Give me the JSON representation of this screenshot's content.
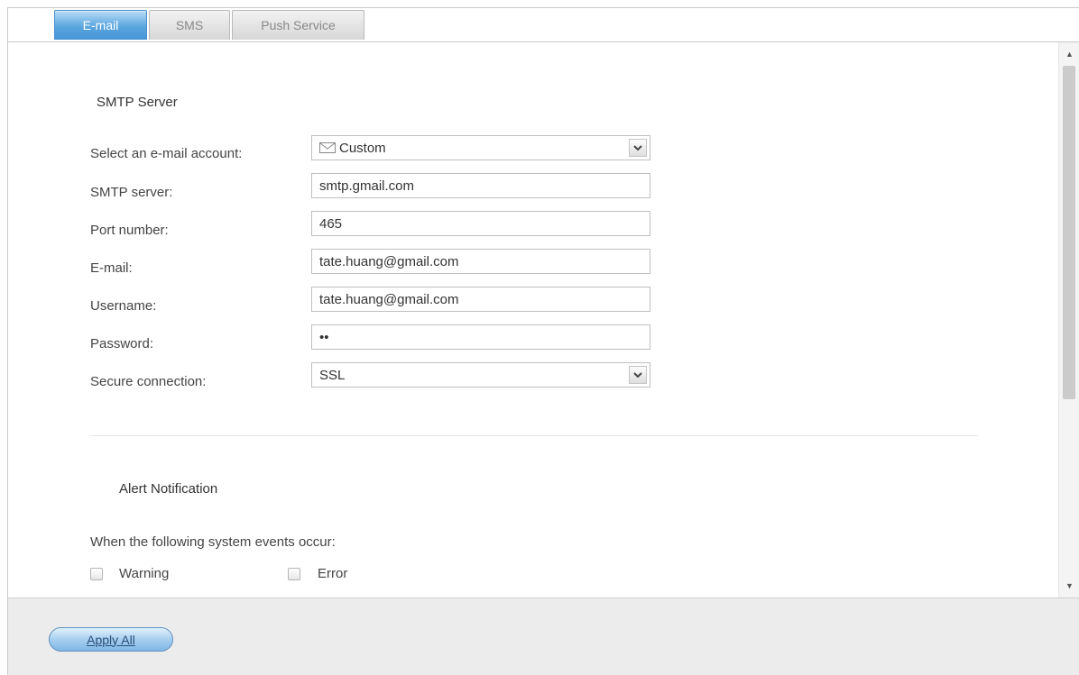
{
  "tabs": [
    {
      "label": "E-mail",
      "active": true
    },
    {
      "label": "SMS",
      "active": false
    },
    {
      "label": "Push Service",
      "active": false
    }
  ],
  "smtp": {
    "title": "SMTP Server",
    "fields": {
      "account": {
        "label": "Select an e-mail account:",
        "value": "Custom",
        "icon": "envelope-icon"
      },
      "server": {
        "label": "SMTP server:",
        "value": "smtp.gmail.com"
      },
      "port": {
        "label": "Port number:",
        "value": "465"
      },
      "email": {
        "label": "E-mail:",
        "value": "tate.huang@gmail.com"
      },
      "username": {
        "label": "Username:",
        "value": "tate.huang@gmail.com"
      },
      "password": {
        "label": "Password:",
        "value": "••"
      },
      "secure": {
        "label": "Secure connection:",
        "value": "SSL"
      }
    }
  },
  "alert": {
    "title": "Alert Notification",
    "description": "When the following system events occur:",
    "options": [
      {
        "label": "Warning",
        "checked": false
      },
      {
        "label": "Error",
        "checked": false
      }
    ]
  },
  "footer": {
    "apply_label": "Apply All"
  },
  "colors": {
    "active_tab": "#4a98d8",
    "apply_button": "#8cc0ea"
  }
}
